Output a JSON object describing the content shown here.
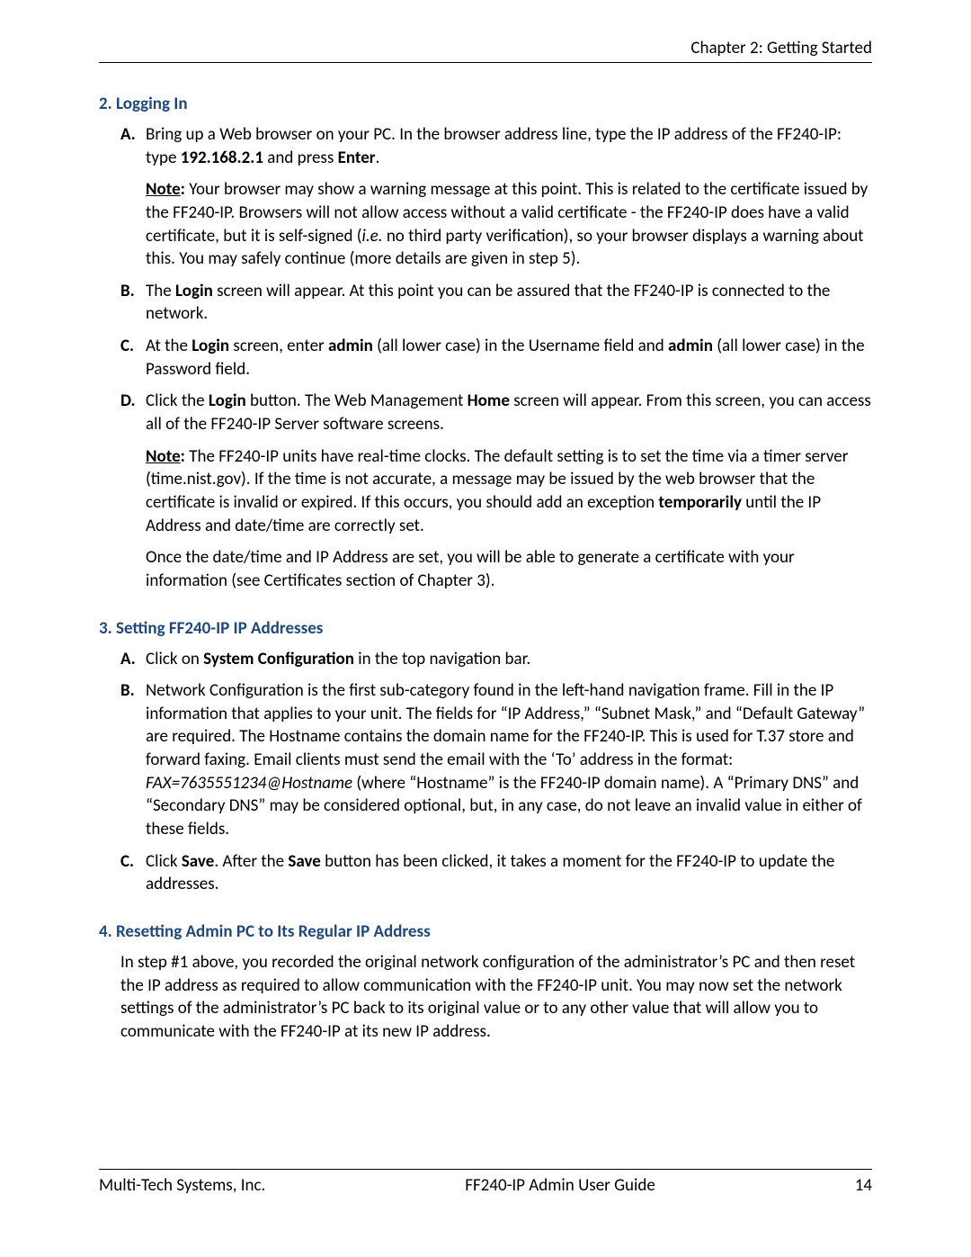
{
  "header": {
    "chapter": "Chapter 2: Getting Started"
  },
  "sections": [
    {
      "num": "2.",
      "title": "Logging In",
      "items": [
        {
          "letter": "A.",
          "html": "Bring up a Web browser on your PC. In the browser address line, type the IP address of the FF240-IP: type <b>192.168.2.1</b> and press <b>Enter</b>.",
          "subs": [
            "<b><span class=\"underline\">Note</span>:</b> Your browser may show a warning message at this point. This is related to the certificate issued by the FF240-IP. Browsers will not allow access without a valid certificate - the FF240-IP does have a valid certificate, but it is self-signed (<i>i.e.</i> no third party verification), so your browser displays a warning about this. You may safely continue (more details are given in step 5)."
          ]
        },
        {
          "letter": "B.",
          "html": "The <b>Login</b> screen will appear. At this point you can be assured that the FF240-IP is connected to the network.",
          "subs": []
        },
        {
          "letter": "C.",
          "html": "At the <b>Login</b> screen, enter <b>admin</b> (all lower case) in the Username field and <b>admin</b> (all lower case) in the Password field.",
          "subs": []
        },
        {
          "letter": "D.",
          "html": "Click the <b>Login</b> button. The Web Management <b>Home</b> screen will appear. From this screen, you can access all of the FF240-IP Server software screens.",
          "subs": [
            "<b><span class=\"underline\">Note</span>:</b> The FF240-IP units have real-time clocks. The default setting is to set the time via a timer server (time.nist.gov). If the time is not accurate, a message may be issued by the web browser that the certificate is invalid or expired. If this occurs, you should add an exception <b>temporarily</b> until the IP Address and date/time are correctly set.",
            "Once the date/time and IP Address are set, you will be able to generate a certificate with your information (see Certificates section of Chapter 3)."
          ]
        }
      ]
    },
    {
      "num": "3.",
      "title": "Setting FF240-IP IP Addresses",
      "items": [
        {
          "letter": "A.",
          "html": "Click on <b>System Configuration</b> in the top navigation bar.",
          "subs": []
        },
        {
          "letter": "B.",
          "html": "Network Configuration is the first sub-category found in the left-hand navigation frame. Fill in the IP information that applies to your unit. The fields for “IP Address,” “Subnet Mask,” and “Default Gateway” are required. The Hostname contains the domain name for the FF240-IP. This is used for T.37 store and forward faxing. Email clients must send the email with the ‘To’ address in the format: <i>FAX=7635551234@Hostname</i> (where “Hostname” is the FF240-IP domain name). A “Primary DNS” and “Secondary DNS” may be considered optional, but, in any case, do not leave an invalid value in either of these fields.",
          "subs": []
        },
        {
          "letter": "C.",
          "html": "Click <b>Save</b>. After the <b>Save</b> button has been clicked, it takes a moment for the FF240-IP to update the addresses.",
          "subs": []
        }
      ]
    },
    {
      "num": "4.",
      "title": "Resetting Admin PC to Its Regular IP Address",
      "body": "In step #1 above, you recorded the original network configuration of the administrator’s PC and then reset the IP address as required to allow communication with the FF240-IP unit. You may now set the network settings of the administrator’s PC back to its original value or to any other value that will allow you to communicate with the FF240-IP at its new IP address."
    }
  ],
  "footer": {
    "left": "Multi-Tech Systems, Inc.",
    "center": "FF240-IP Admin User Guide",
    "right": "14"
  }
}
